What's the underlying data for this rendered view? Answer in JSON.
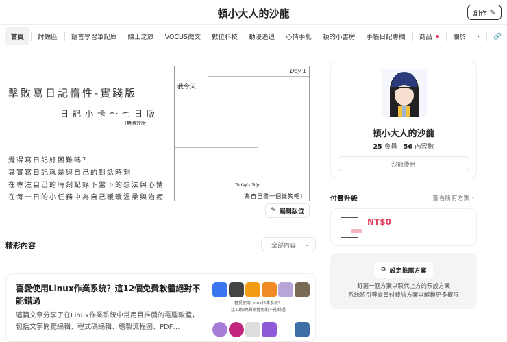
{
  "header": {
    "title": "頓小大人的沙龍",
    "create_label": "創作"
  },
  "nav": {
    "items": [
      "首頁",
      "討論區",
      "語言學習筆記庫",
      "線上之旅",
      "VOCUS徵文",
      "數位科技",
      "動漫追追",
      "心情手札",
      "頓的小書房",
      "手帳日記專欄",
      "商品",
      "關於"
    ],
    "more": "›"
  },
  "banner": {
    "title": "擊敗寫日記惰性-實踐版",
    "subtitle": "日記小卡～七日版",
    "note": "（無時效版）",
    "lines": [
      "覺得寫日記好困難嗎？",
      "其實寫日記就是與自己的對話時刻",
      "在專注自己的時刻記錄下當下的想法與心情",
      "在每一日的小任務中為自己暖暖溫柔與治癒"
    ],
    "card_day": "Day 1",
    "card_me": "我今天",
    "card_trip": "Today's Trip",
    "card_draw": "為自己畫一個微笑吧！",
    "edit_label": "編輯版位"
  },
  "content": {
    "section_title": "精彩內容",
    "filter": "全部內容",
    "post": {
      "title": "喜愛使用Linux作業系統？這12個免費軟體絕對不能錯過",
      "excerpt": "這篇文章分享了在Linux作業系統中常用且推薦的電腦軟體，包括文字閱覽編輯、程式碼編輯、繪製流程圖、PDF…",
      "thumb_caption": [
        "喜愛使用Linux作業系統？",
        "這12個免費軟體絕對不能錯過"
      ]
    }
  },
  "profile": {
    "name": "頓小大人的沙龍",
    "members": "25",
    "members_label": "會員",
    "posts": "56",
    "posts_label": "內容數",
    "admin_label": "沙龍後台"
  },
  "plans": {
    "title": "付費升級",
    "view_all": "查看所有方案 ›",
    "price": "NT$0",
    "rec_button": "設定推薦方案",
    "rec_desc": [
      "釘選一個方案以取代上方的預設方案",
      "系統將引導會員付費該方案以解鎖更多權限"
    ]
  }
}
